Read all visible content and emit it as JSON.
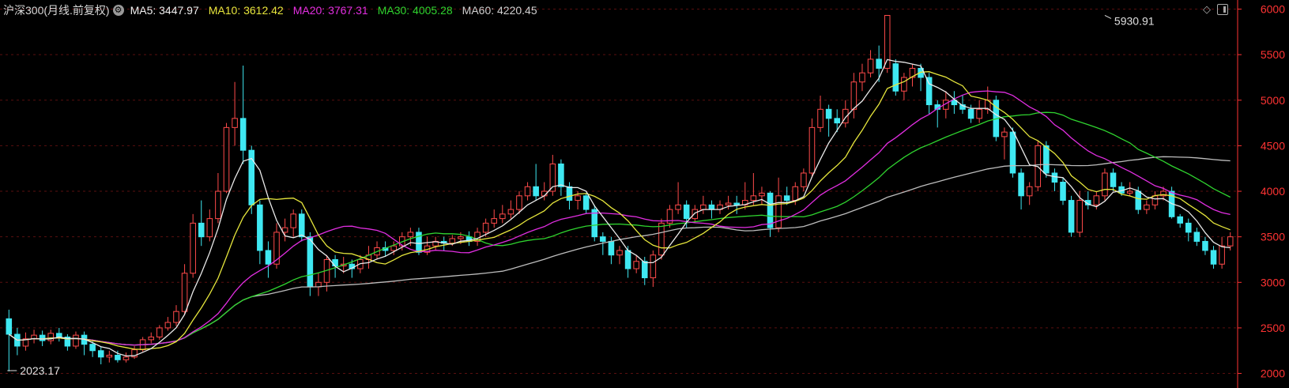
{
  "legend": {
    "title": "沪深300(月线.前复权)",
    "ma5": "MA5: 3447.97",
    "ma10": "MA10: 3612.42",
    "ma20": "MA20: 3767.31",
    "ma30": "MA30: 4005.28",
    "ma60": "MA60: 4220.45"
  },
  "colors": {
    "up": "#ff4a4a",
    "down": "#3fe8f2",
    "ma5": "#eaeaea",
    "ma10": "#e6e63c",
    "ma20": "#e12ee1",
    "ma30": "#2fd42f",
    "ma60": "#bdbdbd",
    "grid": "#5a0f0f",
    "axis": "#ff3333"
  },
  "chart_data": {
    "type": "candlestick",
    "y_axis": {
      "min": 1840,
      "max": 6100,
      "ticks": [
        2000,
        2500,
        3000,
        3500,
        4000,
        4500,
        5000,
        5500,
        6000
      ],
      "position": "right"
    },
    "annotations": [
      {
        "text": "5930.91",
        "index": 131,
        "value": 5930.91,
        "kind": "high"
      },
      {
        "text": "2023.17",
        "index": 0,
        "value": 2023.17,
        "kind": "low"
      }
    ],
    "candles": [
      [
        2600,
        2430,
        2700,
        2023.17
      ],
      [
        2430,
        2300,
        2500,
        2200
      ],
      [
        2300,
        2380,
        2450,
        2250
      ],
      [
        2380,
        2420,
        2480,
        2330
      ],
      [
        2420,
        2360,
        2470,
        2300
      ],
      [
        2360,
        2440,
        2480,
        2320
      ],
      [
        2440,
        2400,
        2500,
        2350
      ],
      [
        2400,
        2300,
        2430,
        2250
      ],
      [
        2300,
        2420,
        2460,
        2270
      ],
      [
        2420,
        2320,
        2460,
        2200
      ],
      [
        2320,
        2250,
        2350,
        2180
      ],
      [
        2250,
        2180,
        2290,
        2100
      ],
      [
        2180,
        2200,
        2250,
        2120
      ],
      [
        2200,
        2150,
        2250,
        2120
      ],
      [
        2150,
        2180,
        2230,
        2120
      ],
      [
        2180,
        2260,
        2300,
        2160
      ],
      [
        2260,
        2370,
        2400,
        2240
      ],
      [
        2370,
        2400,
        2450,
        2330
      ],
      [
        2400,
        2500,
        2530,
        2370
      ],
      [
        2500,
        2560,
        2620,
        2470
      ],
      [
        2560,
        2680,
        2750,
        2520
      ],
      [
        2680,
        3100,
        3200,
        2650
      ],
      [
        3100,
        3650,
        3750,
        3050
      ],
      [
        3650,
        3500,
        3900,
        3400
      ],
      [
        3500,
        3700,
        3800,
        3450
      ],
      [
        3700,
        4000,
        4200,
        3650
      ],
      [
        4000,
        4700,
        4750,
        3980
      ],
      [
        4700,
        4800,
        5200,
        4500
      ],
      [
        4800,
        4450,
        5380,
        4300
      ],
      [
        4450,
        3850,
        4500,
        3750
      ],
      [
        3850,
        3350,
        3900,
        3200
      ],
      [
        3350,
        3200,
        3450,
        3050
      ],
      [
        3200,
        3550,
        3650,
        3150
      ],
      [
        3550,
        3600,
        3700,
        3450
      ],
      [
        3600,
        3750,
        3800,
        3500
      ],
      [
        3750,
        3500,
        3800,
        3450
      ],
      [
        3500,
        2950,
        3550,
        2850
      ],
      [
        2950,
        3000,
        3100,
        2850
      ],
      [
        3000,
        3250,
        3300,
        2900
      ],
      [
        3250,
        3180,
        3300,
        3050
      ],
      [
        3180,
        3200,
        3280,
        3100
      ],
      [
        3200,
        3150,
        3250,
        3050
      ],
      [
        3150,
        3250,
        3300,
        3100
      ],
      [
        3250,
        3300,
        3400,
        3150
      ],
      [
        3300,
        3380,
        3450,
        3250
      ],
      [
        3380,
        3350,
        3450,
        3280
      ],
      [
        3350,
        3400,
        3450,
        3300
      ],
      [
        3400,
        3500,
        3550,
        3350
      ],
      [
        3500,
        3550,
        3600,
        3400
      ],
      [
        3550,
        3330,
        3600,
        3300
      ],
      [
        3330,
        3400,
        3500,
        3300
      ],
      [
        3400,
        3450,
        3500,
        3350
      ],
      [
        3450,
        3430,
        3500,
        3350
      ],
      [
        3430,
        3480,
        3520,
        3400
      ],
      [
        3480,
        3500,
        3550,
        3420
      ],
      [
        3500,
        3450,
        3560,
        3400
      ],
      [
        3450,
        3550,
        3600,
        3400
      ],
      [
        3550,
        3650,
        3700,
        3500
      ],
      [
        3650,
        3700,
        3800,
        3600
      ],
      [
        3700,
        3750,
        3850,
        3650
      ],
      [
        3750,
        3800,
        3900,
        3700
      ],
      [
        3800,
        3950,
        4000,
        3750
      ],
      [
        3950,
        4050,
        4100,
        3900
      ],
      [
        4050,
        3950,
        4300,
        3900
      ],
      [
        3950,
        4000,
        4100,
        3900
      ],
      [
        4000,
        4300,
        4400,
        3950
      ],
      [
        4300,
        4050,
        4350,
        3950
      ],
      [
        4050,
        3900,
        4100,
        3800
      ],
      [
        3900,
        3950,
        4000,
        3800
      ],
      [
        3950,
        3800,
        3980,
        3750
      ],
      [
        3800,
        3500,
        3850,
        3450
      ],
      [
        3500,
        3450,
        3550,
        3300
      ],
      [
        3450,
        3300,
        3500,
        3200
      ],
      [
        3300,
        3350,
        3400,
        3200
      ],
      [
        3350,
        3150,
        3400,
        3050
      ],
      [
        3150,
        3230,
        3300,
        3100
      ],
      [
        3230,
        3050,
        3280,
        2970
      ],
      [
        3050,
        3300,
        3350,
        2950
      ],
      [
        3300,
        3650,
        3700,
        3250
      ],
      [
        3650,
        3800,
        3850,
        3600
      ],
      [
        3800,
        3850,
        4100,
        3750
      ],
      [
        3850,
        3700,
        3900,
        3600
      ],
      [
        3700,
        3800,
        3850,
        3650
      ],
      [
        3800,
        3850,
        3950,
        3750
      ],
      [
        3850,
        3800,
        3900,
        3700
      ],
      [
        3800,
        3850,
        3900,
        3750
      ],
      [
        3850,
        3870,
        3950,
        3800
      ],
      [
        3870,
        3850,
        3950,
        3750
      ],
      [
        3850,
        3900,
        4100,
        3800
      ],
      [
        3900,
        3950,
        4200,
        3850
      ],
      [
        3950,
        3980,
        4050,
        3850
      ],
      [
        3980,
        3600,
        4000,
        3500
      ],
      [
        3600,
        3950,
        4150,
        3550
      ],
      [
        3950,
        3900,
        4050,
        3850
      ],
      [
        3900,
        4050,
        4100,
        3850
      ],
      [
        4050,
        4200,
        4250,
        4000
      ],
      [
        4200,
        4700,
        4800,
        4150
      ],
      [
        4700,
        4900,
        5050,
        4650
      ],
      [
        4900,
        4800,
        4950,
        4600
      ],
      [
        4800,
        4750,
        4900,
        4650
      ],
      [
        4750,
        4900,
        5000,
        4700
      ],
      [
        4900,
        5200,
        5300,
        4800
      ],
      [
        5200,
        5300,
        5400,
        5100
      ],
      [
        5300,
        5450,
        5550,
        5250
      ],
      [
        5450,
        5350,
        5600,
        5200
      ],
      [
        5350,
        5930.91,
        5930.91,
        5300
      ],
      [
        5400,
        5100,
        5450,
        5050
      ],
      [
        5100,
        5250,
        5300,
        5000
      ],
      [
        5250,
        5350,
        5400,
        5150
      ],
      [
        5350,
        5250,
        5400,
        5100
      ],
      [
        5250,
        4950,
        5300,
        4850
      ],
      [
        4950,
        4900,
        5000,
        4700
      ],
      [
        4900,
        5000,
        5100,
        4800
      ],
      [
        5000,
        4950,
        5100,
        4850
      ],
      [
        4950,
        4900,
        5050,
        4850
      ],
      [
        4900,
        4800,
        4950,
        4750
      ],
      [
        4800,
        4900,
        5000,
        4750
      ],
      [
        4900,
        5000,
        5150,
        4850
      ],
      [
        5000,
        4600,
        5050,
        4550
      ],
      [
        4600,
        4650,
        4700,
        4350
      ],
      [
        4650,
        4200,
        4700,
        4150
      ],
      [
        4200,
        3950,
        4250,
        3800
      ],
      [
        3950,
        4050,
        4100,
        3850
      ],
      [
        4050,
        4500,
        4550,
        4000
      ],
      [
        4500,
        4200,
        4550,
        4150
      ],
      [
        4200,
        4100,
        4250,
        4000
      ],
      [
        4100,
        3900,
        4150,
        3850
      ],
      [
        3900,
        3550,
        3950,
        3500
      ],
      [
        3550,
        3900,
        4000,
        3500
      ],
      [
        3900,
        3850,
        4000,
        3800
      ],
      [
        3850,
        3950,
        4000,
        3800
      ],
      [
        3950,
        4200,
        4250,
        3900
      ],
      [
        4200,
        4050,
        4250,
        4000
      ],
      [
        4050,
        3980,
        4100,
        3950
      ],
      [
        3980,
        4000,
        4100,
        3950
      ],
      [
        4000,
        3800,
        4050,
        3750
      ],
      [
        3800,
        3850,
        3900,
        3750
      ],
      [
        3850,
        3950,
        4000,
        3800
      ],
      [
        3950,
        4000,
        4050,
        3900
      ],
      [
        4000,
        3720,
        4050,
        3700
      ],
      [
        3720,
        3650,
        3750,
        3600
      ],
      [
        3650,
        3550,
        3700,
        3450
      ],
      [
        3550,
        3450,
        3600,
        3400
      ],
      [
        3450,
        3350,
        3500,
        3300
      ],
      [
        3350,
        3200,
        3400,
        3150
      ],
      [
        3200,
        3400,
        3500,
        3150
      ],
      [
        3400,
        3500,
        3550,
        3350
      ]
    ]
  }
}
